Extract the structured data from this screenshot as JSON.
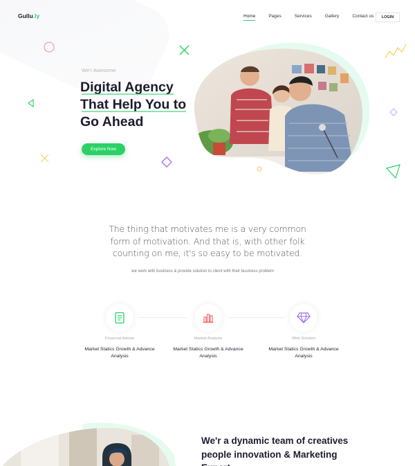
{
  "brand": {
    "name": "Gullu",
    "suffix": ".ly",
    "accent": "#2bd166"
  },
  "nav": {
    "items": [
      {
        "label": "Home",
        "active": true
      },
      {
        "label": "Pages",
        "active": false
      },
      {
        "label": "Services",
        "active": false
      },
      {
        "label": "Gallery",
        "active": false
      },
      {
        "label": "Contact us",
        "active": false
      }
    ],
    "login_label": "LOGIN"
  },
  "hero": {
    "eyebrow": "We'r Awesome",
    "title_lines": [
      "Digital Agency",
      "That Help You to",
      "Go Ahead"
    ],
    "cta_label": "Explore Now"
  },
  "intro": {
    "quote": "The thing that motivates me is a very common form of motivation. And that is, with other folk counting on me, it's so easy to be motivated.",
    "subtext": "we work with business & provide solution to client with their business problem"
  },
  "services": [
    {
      "icon": "document-icon",
      "category": "Financial Advise",
      "title": "Market Statics Growth & Advance Analysis"
    },
    {
      "icon": "bar-chart-icon",
      "category": "Market Analysis",
      "title": "Market Statics Growth & Advance Analysis"
    },
    {
      "icon": "diamond-icon",
      "category": "Web Solution",
      "title": "Market Statics Growth & Advance Analysis"
    }
  ],
  "team": {
    "title": "We'r a dynamic team of creatives people innovation & Marketing Expert"
  }
}
